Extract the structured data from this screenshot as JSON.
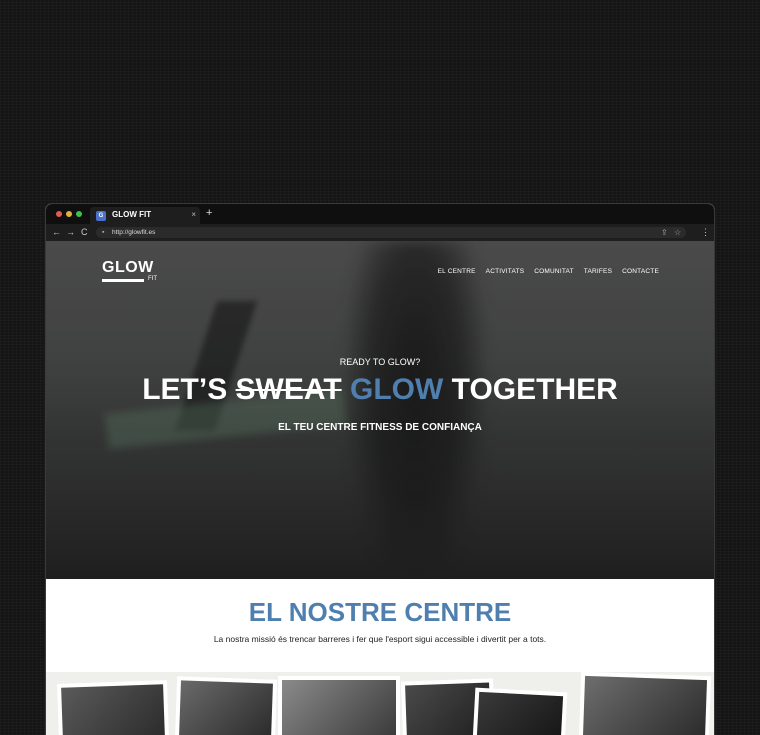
{
  "browser": {
    "tab_title": "GLOW FIT",
    "tab_close": "×",
    "new_tab": "+",
    "url": "http://glowfit.es",
    "nav_back": "←",
    "nav_forward": "→",
    "nav_reload": "C",
    "share_icon": "⇪",
    "star_icon": "☆",
    "menu_icon": "⋮"
  },
  "site": {
    "logo": "GLOW",
    "logo_sub": "FIT",
    "nav": [
      "EL CENTRE",
      "ACTIVITATS",
      "COMUNITAT",
      "TARIFES",
      "CONTACTE"
    ],
    "hero": {
      "kicker": "READY TO GLOW?",
      "headline_part1": "LET’S ",
      "headline_strike": "SWEAT",
      "headline_blue": "GLOW",
      "headline_part2": "TOGETHER",
      "subline": "EL TEU CENTRE FITNESS DE CONFIANÇA"
    },
    "section": {
      "title": "EL NOSTRE CENTRE",
      "subtitle": "La nostra missió és trencar barreres i fer que l'esport sigui accessible i divertit per a tots."
    }
  },
  "colors": {
    "accent": "#4e7fae",
    "dot_red": "#e25b4f",
    "dot_yellow": "#e2b03f",
    "dot_green": "#3fbf4e"
  }
}
